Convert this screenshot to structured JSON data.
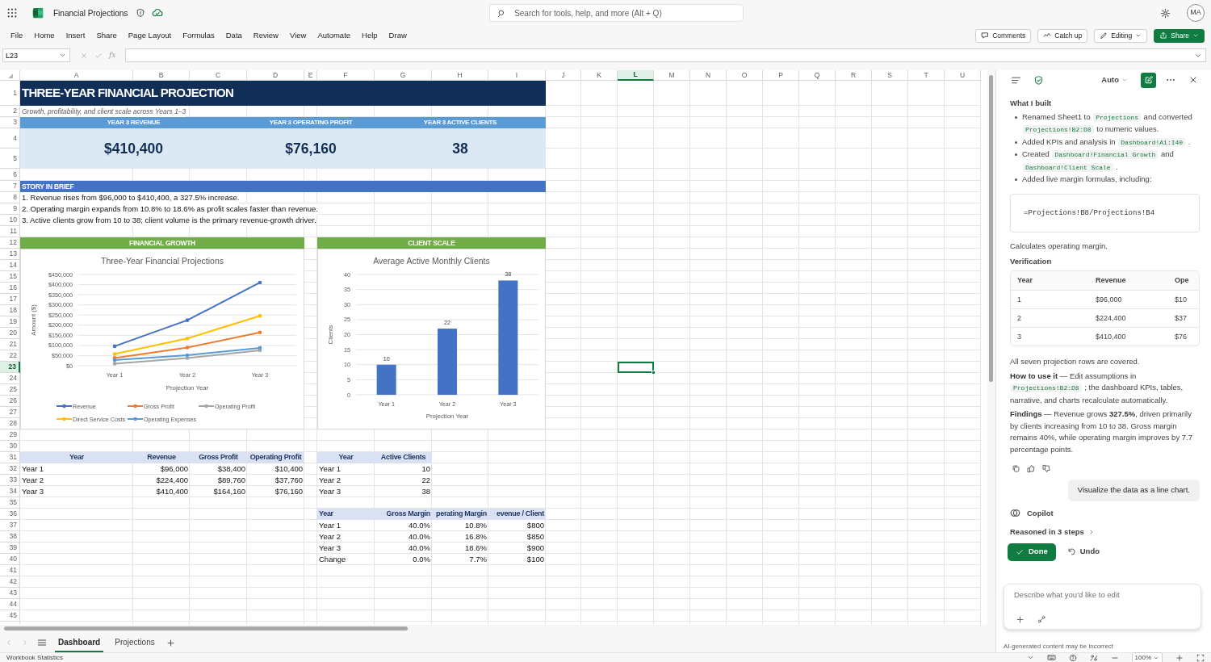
{
  "app": {
    "title": "Financial Projections",
    "search_placeholder": "Search for tools, help, and more (Alt + Q)",
    "avatar": "MA"
  },
  "menu": [
    "File",
    "Home",
    "Insert",
    "Share",
    "Page Layout",
    "Formulas",
    "Data",
    "Review",
    "View",
    "Automate",
    "Help",
    "Draw"
  ],
  "toolbar_buttons": [
    {
      "label": "Comments",
      "kind": "outline"
    },
    {
      "label": "Catch up",
      "kind": "outline"
    },
    {
      "label": "Editing",
      "kind": "dropdown"
    },
    {
      "label": "Share",
      "kind": "primary"
    }
  ],
  "formula_bar": {
    "name_box": "L23",
    "function_label": "fx"
  },
  "sheet": {
    "columns": [
      {
        "label": "A",
        "selected": false
      },
      {
        "label": "B",
        "selected": false
      },
      {
        "label": "C",
        "selected": false
      },
      {
        "label": "D",
        "selected": false
      },
      {
        "label": "E",
        "selected": false
      },
      {
        "label": "F",
        "selected": false
      },
      {
        "label": "G",
        "selected": false
      },
      {
        "label": "H",
        "selected": false
      },
      {
        "label": "I",
        "selected": false
      },
      {
        "label": "J",
        "selected": false
      },
      {
        "label": "K",
        "selected": false
      },
      {
        "label": "L",
        "selected": true
      },
      {
        "label": "M",
        "selected": false
      },
      {
        "label": "N",
        "selected": false
      },
      {
        "label": "O",
        "selected": false
      },
      {
        "label": "P",
        "selected": false
      },
      {
        "label": "Q",
        "selected": false
      },
      {
        "label": "R",
        "selected": false
      },
      {
        "label": "S",
        "selected": false
      },
      {
        "label": "T",
        "selected": false
      },
      {
        "label": "U",
        "selected": false
      }
    ],
    "rows": [
      {
        "label": "1",
        "selected": false
      },
      {
        "label": "2",
        "selected": false
      },
      {
        "label": "3",
        "selected": false
      },
      {
        "label": "4",
        "selected": false
      },
      {
        "label": "5",
        "selected": false
      },
      {
        "label": "6",
        "selected": false
      },
      {
        "label": "7",
        "selected": false
      },
      {
        "label": "8",
        "selected": false
      },
      {
        "label": "9",
        "selected": false
      },
      {
        "label": "10",
        "selected": false
      },
      {
        "label": "11",
        "selected": false
      },
      {
        "label": "12",
        "selected": false
      },
      {
        "label": "13",
        "selected": false
      },
      {
        "label": "14",
        "selected": false
      },
      {
        "label": "15",
        "selected": false
      },
      {
        "label": "16",
        "selected": false
      },
      {
        "label": "17",
        "selected": false
      },
      {
        "label": "18",
        "selected": false
      },
      {
        "label": "19",
        "selected": false
      },
      {
        "label": "20",
        "selected": false
      },
      {
        "label": "21",
        "selected": false
      },
      {
        "label": "22",
        "selected": false
      },
      {
        "label": "23",
        "selected": true
      },
      {
        "label": "24",
        "selected": false
      },
      {
        "label": "25",
        "selected": false
      },
      {
        "label": "26",
        "selected": false
      },
      {
        "label": "27",
        "selected": false
      },
      {
        "label": "28",
        "selected": false
      },
      {
        "label": "29",
        "selected": false
      },
      {
        "label": "30",
        "selected": false
      },
      {
        "label": "31",
        "selected": false
      },
      {
        "label": "32",
        "selected": false
      },
      {
        "label": "33",
        "selected": false
      },
      {
        "label": "34",
        "selected": false
      },
      {
        "label": "35",
        "selected": false
      },
      {
        "label": "36",
        "selected": false
      },
      {
        "label": "37",
        "selected": false
      },
      {
        "label": "38",
        "selected": false
      },
      {
        "label": "39",
        "selected": false
      },
      {
        "label": "40",
        "selected": false
      },
      {
        "label": "41",
        "selected": false
      },
      {
        "label": "42",
        "selected": false
      },
      {
        "label": "43",
        "selected": false
      },
      {
        "label": "44",
        "selected": false
      },
      {
        "label": "45",
        "selected": false
      }
    ],
    "title": "THREE-YEAR FINANCIAL PROJECTION",
    "subtitle": "Growth, profitability, and client scale across Years 1–3",
    "kpis": [
      {
        "label": "YEAR 3 REVENUE",
        "value": "$410,400"
      },
      {
        "label": "YEAR 3 OPERATING PROFIT",
        "value": "$76,160"
      },
      {
        "label": "YEAR 3 ACTIVE CLIENTS",
        "value": "38"
      }
    ],
    "story": {
      "heading": "STORY IN BRIEF",
      "lines": [
        "1. Revenue rises from $96,000 to $410,400, a 327.5% increase.",
        "2. Operating margin expands from 10.8% to 18.6% as profit scales faster than revenue.",
        "3. Active clients grow from 10 to 38; client volume is the primary revenue-growth driver."
      ]
    },
    "sections": [
      {
        "heading": "FINANCIAL GROWTH",
        "chart_data": {
          "type": "line",
          "title": "Three-Year Financial Projections",
          "xlabel": "Projection Year",
          "ylabel": "Amount ($)",
          "categories": [
            "Year 1",
            "Year 2",
            "Year 3"
          ],
          "series": [
            {
              "name": "Revenue",
              "color": "#4472c4",
              "values": [
                96000,
                224400,
                410400
              ]
            },
            {
              "name": "Gross Profit",
              "color": "#ed7d31",
              "values": [
                38400,
                89760,
                164160
              ]
            },
            {
              "name": "Operating Profit",
              "color": "#a5a5a5",
              "values": [
                10400,
                37760,
                76160
              ]
            },
            {
              "name": "Direct Service Costs",
              "color": "#ffc000",
              "values": [
                57600,
                134640,
                246240
              ]
            },
            {
              "name": "Operating Expenses",
              "color": "#5b9bd5",
              "values": [
                28000,
                52000,
                88000
              ]
            }
          ],
          "ylim": [
            0,
            450000
          ],
          "grid": true,
          "legend": true,
          "yticks": [
            {
              "value": 0,
              "label": "$0"
            },
            {
              "value": 50000,
              "label": "$50,000"
            },
            {
              "value": 100000,
              "label": "$100,000"
            },
            {
              "value": 150000,
              "label": "$150,000"
            },
            {
              "value": 200000,
              "label": "$200,000"
            },
            {
              "value": 250000,
              "label": "$250,000"
            },
            {
              "value": 300000,
              "label": "$300,000"
            },
            {
              "value": 350000,
              "label": "$350,000"
            },
            {
              "value": 400000,
              "label": "$400,000"
            },
            {
              "value": 450000,
              "label": "$450,000"
            }
          ]
        }
      },
      {
        "heading": "CLIENT SCALE",
        "chart_data": {
          "type": "bar",
          "title": "Average Active Monthly Clients",
          "xlabel": "Projection Year",
          "ylabel": "Clients",
          "categories": [
            "Year 1",
            "Year 2",
            "Year 3"
          ],
          "series": [
            {
              "color": "#4472c4",
              "values": [
                10,
                22,
                38
              ]
            }
          ],
          "ylim": [
            0,
            40
          ],
          "grid": true,
          "yticks": [
            0,
            5,
            10,
            15,
            20,
            25,
            30,
            35,
            40
          ],
          "data_labels": true
        }
      }
    ],
    "tables": [
      {
        "columns": [
          "Year",
          "Revenue",
          "Gross Profit",
          "Operating Profit"
        ],
        "rows": [
          [
            "Year 1",
            "$96,000",
            "$38,400",
            "$10,400"
          ],
          [
            "Year 2",
            "$224,400",
            "$89,760",
            "$37,760"
          ],
          [
            "Year 3",
            "$410,400",
            "$164,160",
            "$76,160"
          ]
        ]
      },
      {
        "columns": [
          "Year",
          "Active Clients"
        ],
        "rows": [
          [
            "Year 1",
            "10"
          ],
          [
            "Year 2",
            "22"
          ],
          [
            "Year 3",
            "38"
          ]
        ]
      },
      {
        "columns": [
          "Year",
          "Gross Margin",
          "perating Margin",
          "evenue / Client"
        ],
        "rows": [
          [
            "Year 1",
            "40.0%",
            "10.8%",
            "$800"
          ],
          [
            "Year 2",
            "40.0%",
            "16.8%",
            "$850"
          ],
          [
            "Year 3",
            "40.0%",
            "18.6%",
            "$900"
          ],
          [
            "Change",
            "0.0%",
            "7.7%",
            "$100"
          ]
        ]
      }
    ]
  },
  "sheet_tabs": [
    {
      "label": "Dashboard",
      "selected": true
    },
    {
      "label": "Projections",
      "selected": false
    }
  ],
  "copilot": {
    "mode": "Auto",
    "heading": "What I built",
    "bullets": [
      [
        {
          "kind": "text",
          "text": "Renamed Sheet1 to "
        },
        {
          "kind": "code",
          "text": "Projections"
        },
        {
          "kind": "text",
          "text": " and converted "
        },
        {
          "kind": "code",
          "text": "Projections!B2:D8"
        },
        {
          "kind": "text",
          "text": " to numeric values."
        }
      ],
      [
        {
          "kind": "text",
          "text": "Added KPIs and analysis in "
        },
        {
          "kind": "code",
          "text": "Dashboard!A1:I40"
        },
        {
          "kind": "text",
          "text": " ."
        }
      ],
      [
        {
          "kind": "text",
          "text": "Created "
        },
        {
          "kind": "code",
          "text": "Dashboard!Financial Growth"
        },
        {
          "kind": "text",
          "text": " and "
        },
        {
          "kind": "code",
          "text": "Dashboard!Client Scale"
        },
        {
          "kind": "text",
          "text": " ."
        }
      ],
      [
        {
          "kind": "text",
          "text": "Added live margin formulas, including:"
        }
      ]
    ],
    "code_block": "=Projections!B8/Projections!B4",
    "code_caption": "Calculates operating margin.",
    "verification": {
      "heading": "Verification",
      "columns": [
        "Year",
        "Revenue",
        "Ope"
      ],
      "rows": [
        [
          "1",
          "$96,000",
          "$10"
        ],
        [
          "2",
          "$224,400",
          "$37"
        ],
        [
          "3",
          "$410,400",
          "$76"
        ]
      ]
    },
    "paragraphs": [
      [
        {
          "kind": "text",
          "text": "All seven projection rows are covered."
        }
      ],
      [
        {
          "kind": "bold",
          "text": "How to use it"
        },
        {
          "kind": "text",
          "text": " — Edit assumptions in "
        },
        {
          "kind": "code",
          "text": "Projections!B2:D8"
        },
        {
          "kind": "text",
          "text": " ; the dashboard KPIs, tables, narrative, and charts recalculate automatically."
        }
      ],
      [
        {
          "kind": "bold",
          "text": "Findings"
        },
        {
          "kind": "text",
          "text": " — Revenue grows "
        },
        {
          "kind": "bold",
          "text": "327.5%"
        },
        {
          "kind": "text",
          "text": ", driven primarily by clients increasing from 10 to 38. Gross margin remains 40%, while operating margin improves by 7.7 percentage points."
        }
      ]
    ],
    "user_message": "Visualize the data as a line chart.",
    "assistant_name": "Copilot",
    "reasoning": "Reasoned in 3 steps",
    "done_button": "Done",
    "undo_button": "Undo",
    "input_placeholder": "Describe what you'd like to edit",
    "disclaimer": "AI-generated content may be incorrect"
  },
  "status_bar": {
    "label": "Workbook Statistics",
    "zoom": "100%"
  }
}
